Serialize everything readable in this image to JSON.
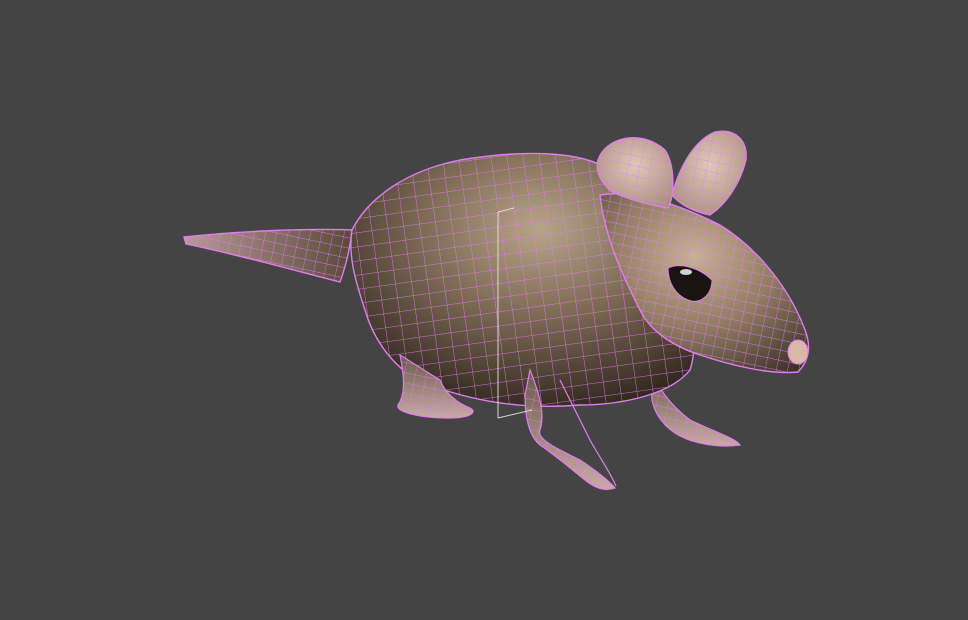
{
  "viewport": {
    "background": "#444444",
    "wire_color": "#e07ef0",
    "selection_bracket_color": "#e6e6e6"
  },
  "model": {
    "object": "mouse-mesh",
    "display_mode": "shaded-with-edged-faces",
    "base_color": "#7a6a55",
    "highlight_color": "#c9b49a",
    "shadow_color": "#2a221a",
    "ear_color": "#cdb1a0"
  }
}
